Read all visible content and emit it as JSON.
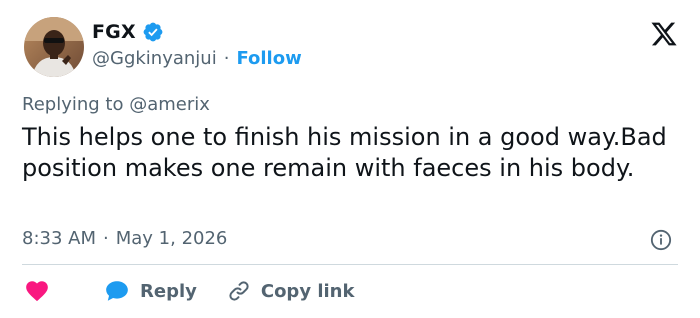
{
  "user": {
    "display_name": "FGX",
    "handle": "@Ggkinyanjui",
    "separator": "·",
    "follow_label": "Follow",
    "verified": true
  },
  "tweet": {
    "replying_prefix": "Replying to",
    "replying_to": "@amerix",
    "text": "This helps one to finish his mission in a good way.Bad position makes one remain with faeces in his body.",
    "time": "8:33 AM",
    "date": "May 1, 2026",
    "separator": "·"
  },
  "actions": {
    "like_icon": "heart-icon",
    "reply_label": "Reply",
    "reply_icon": "speech-bubble-icon",
    "copy_link_label": "Copy link",
    "copy_link_icon": "link-icon"
  },
  "colors": {
    "text": "#0f1419",
    "muted": "#536471",
    "accent": "#1d9bf0",
    "like": "#f91880",
    "divider": "#cfd9de"
  },
  "brand_icon": "x-logo-icon",
  "info_icon": "info-icon"
}
